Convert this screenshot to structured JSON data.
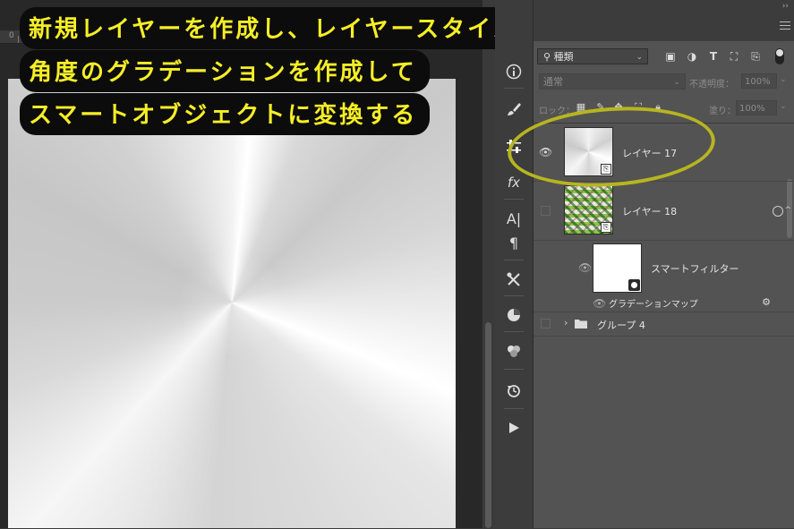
{
  "caption": {
    "line1": "新規レイヤーを作成し、レイヤースタイルで",
    "line2": "角度のグラデーションを作成して",
    "line3": "スマートオブジェクトに変換する",
    "color": "#f6ee26"
  },
  "ruler": {
    "label": "0"
  },
  "toolbar": {
    "info_icon": "info-icon",
    "brush_icon": "brush-icon",
    "adjust_icon": "adjustments-icon",
    "fx_label": "fx",
    "char_label": "A|",
    "para_label": "¶",
    "tools_icon": "tools-icon",
    "color_icon": "color-icon",
    "swatches_icon": "swatches-icon",
    "history_icon": "history-icon",
    "play_icon": "play-icon"
  },
  "layers_panel": {
    "filter": {
      "selected": "種類"
    },
    "blend_mode": "通常",
    "opacity_label": "不透明度：",
    "opacity_value": "100%",
    "lock_label": "ロック：",
    "fill_label": "塗り：",
    "fill_value": "100%",
    "layers": [
      {
        "name": "レイヤー 17",
        "visible": true,
        "smart_object": true
      },
      {
        "name": "レイヤー 18",
        "visible": false,
        "smart_object": true
      },
      {
        "name": "スマートフィルター",
        "visible": true
      },
      {
        "name": "グラデーションマップ",
        "visible": true
      },
      {
        "name": "グループ 4",
        "visible": false,
        "is_group": true
      }
    ]
  },
  "highlight_color": "#b7b520"
}
